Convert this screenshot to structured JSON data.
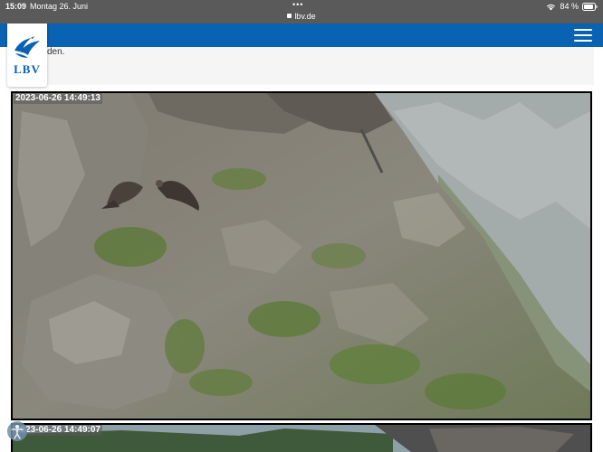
{
  "status_bar": {
    "time": "15:09",
    "date": "Montag 26. Juni",
    "url": "lbv.de",
    "battery": "84 %"
  },
  "logo": {
    "text": "LBV"
  },
  "content": {
    "text": "den."
  },
  "webcams": [
    {
      "timestamp": "2023-06-26 14:49:13"
    },
    {
      "timestamp": "2023-06-26 14:49:07"
    }
  ],
  "colors": {
    "brand_blue": "#0a62b2",
    "status_bar": "#5a5a5a"
  },
  "icons": [
    "lock-icon",
    "wifi-icon",
    "battery-icon",
    "menu-icon",
    "lbv-bird-logo",
    "accessibility-icon"
  ]
}
